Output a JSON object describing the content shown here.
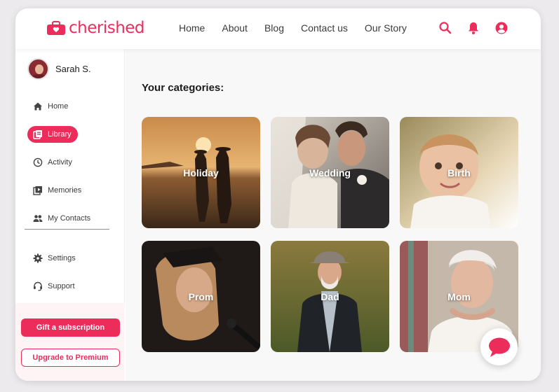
{
  "brand": {
    "name": "cherished",
    "color": "#ec2d5c"
  },
  "nav": {
    "items": [
      "Home",
      "About",
      "Blog",
      "Contact us",
      "Our Story"
    ]
  },
  "header_icons": [
    "search-icon",
    "bell-icon",
    "account-icon"
  ],
  "user": {
    "name": "Sarah S."
  },
  "sidebar": {
    "items": [
      {
        "label": "Home",
        "icon": "home-icon"
      },
      {
        "label": "Library",
        "icon": "library-icon",
        "active": true
      },
      {
        "label": "Activity",
        "icon": "clock-icon"
      },
      {
        "label": "Memories",
        "icon": "memories-icon"
      },
      {
        "label": "My Contacts",
        "icon": "contacts-icon"
      },
      {
        "label": "Settings",
        "icon": "gear-icon"
      },
      {
        "label": "Support",
        "icon": "headset-icon"
      }
    ],
    "gift_label": "Gift a subscription",
    "upgrade_label": "Upgrade to Premium"
  },
  "main": {
    "title": "Your categories:",
    "categories": [
      {
        "label": "Holiday"
      },
      {
        "label": "Wedding"
      },
      {
        "label": "Birth"
      },
      {
        "label": "Prom"
      },
      {
        "label": "Dad"
      },
      {
        "label": "Mom"
      }
    ]
  },
  "chat": {
    "icon": "chat-bubble-icon"
  }
}
